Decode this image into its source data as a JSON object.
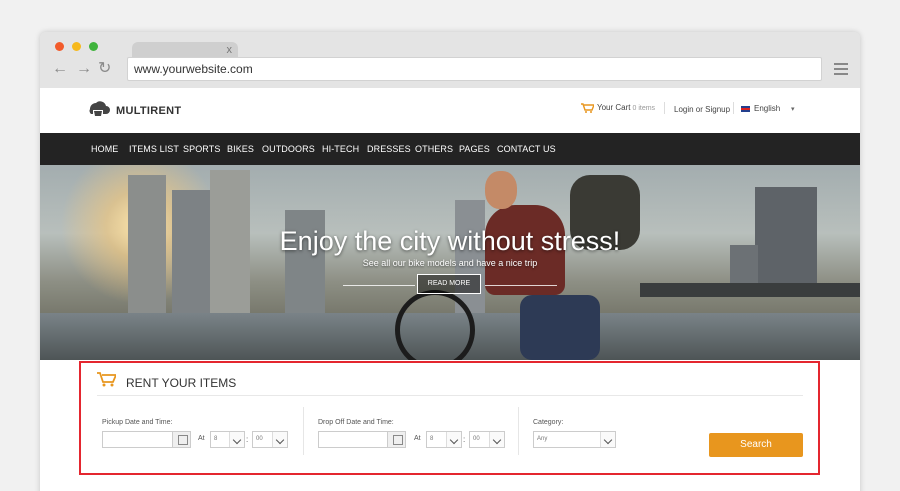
{
  "browser": {
    "url": "www.yourwebsite.com",
    "tab_close": "x",
    "back_glyph": "←",
    "forward_glyph": "→",
    "reload_glyph": "↻"
  },
  "header": {
    "logo": "MULTIRENT",
    "cart_label": "Your Cart",
    "cart_count": "0 items",
    "login": "Login or Signup",
    "language": "English",
    "language_caret": "▾"
  },
  "nav": {
    "items": [
      "HOME",
      "ITEMS LIST",
      "SPORTS",
      "BIKES",
      "OUTDOORS",
      "HI-TECH",
      "DRESSES",
      "OTHERS",
      "PAGES",
      "CONTACT US"
    ]
  },
  "hero": {
    "title": "Enjoy the city without stress!",
    "subtitle": "See all our bike models and have a nice trip",
    "button": "READ MORE"
  },
  "rent": {
    "title": "RENT YOUR ITEMS",
    "pickup_label": "Pickup Date and Time:",
    "dropoff_label": "Drop Off Date and Time:",
    "at_label": "At",
    "colon": ":",
    "hour_value": "8",
    "minute_value": "00",
    "category_label": "Category:",
    "category_value": "Any",
    "search_button": "Search"
  },
  "colors": {
    "accent": "#e8961e",
    "highlight": "#e4262f",
    "navbar": "#232323"
  },
  "icons": [
    "search-icon",
    "cart-icon",
    "calendar-icon",
    "menu-icon",
    "logo-icon"
  ]
}
